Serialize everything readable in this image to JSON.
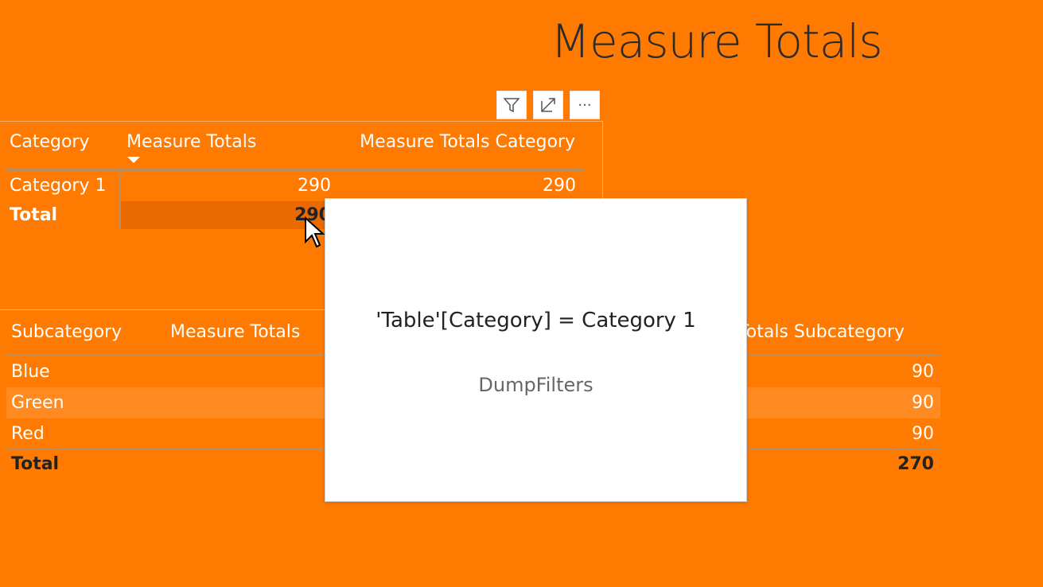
{
  "page_title": "Measure Totals",
  "toolbar": {
    "filter_icon": "filter-icon",
    "focus_icon": "focus-mode-icon",
    "more_label": "···"
  },
  "table1": {
    "headers": [
      "Category",
      "Measure Totals",
      "Measure Totals Category"
    ],
    "sort_indicator": "sort-descending-icon",
    "rows": [
      {
        "category": "Category 1",
        "measure_totals": "290",
        "measure_totals_category": "290"
      }
    ],
    "total": {
      "label": "Total",
      "measure_totals": "290"
    }
  },
  "table2": {
    "headers": [
      "Subcategory",
      "Measure Totals",
      "Measure Totals Subcategory"
    ],
    "rows": [
      {
        "subcategory": "Blue",
        "measure_totals_subcategory": "90"
      },
      {
        "subcategory": "Green",
        "measure_totals_subcategory": "90"
      },
      {
        "subcategory": "Red",
        "measure_totals_subcategory": "90"
      }
    ],
    "total": {
      "label": "Total",
      "measure_totals_subcategory": "270"
    }
  },
  "tooltip": {
    "filter_text": "'Table'[Category] = Category 1",
    "measure_name": "DumpFilters"
  },
  "colors": {
    "background": "#ff7a00",
    "tooltip": "#ffffff",
    "title": "#2b2b2b"
  }
}
